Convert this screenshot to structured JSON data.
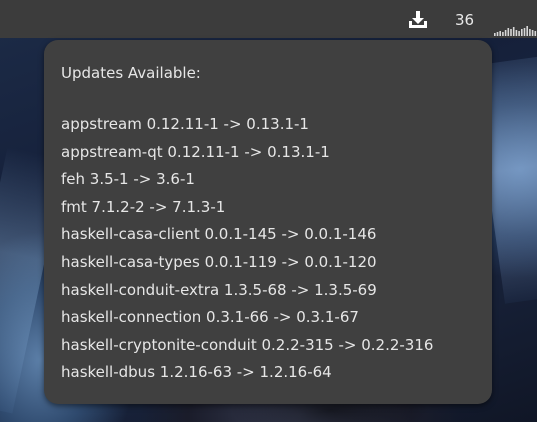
{
  "topbar": {
    "update_icon": "download-tray-icon",
    "update_count": "36",
    "graph_icon": "cpu-usage-graph-icon"
  },
  "popup": {
    "title": "Updates Available:",
    "updates": [
      "appstream 0.12.11-1 -> 0.13.1-1",
      "appstream-qt 0.12.11-1 -> 0.13.1-1",
      "feh 3.5-1 -> 3.6-1",
      "fmt 7.1.2-2 -> 7.1.3-1",
      "haskell-casa-client 0.0.1-145 -> 0.0.1-146",
      "haskell-casa-types 0.0.1-119 -> 0.0.1-120",
      "haskell-conduit-extra 1.3.5-68 -> 1.3.5-69",
      "haskell-connection 0.3.1-66 -> 0.3.1-67",
      "haskell-cryptonite-conduit 0.2.2-315 -> 0.2.2-316",
      "haskell-dbus 1.2.16-63 -> 1.2.16-64"
    ]
  },
  "colors": {
    "panel": "#3c3c3c",
    "popup_bg": "#404040",
    "text": "#e6e6e6"
  }
}
